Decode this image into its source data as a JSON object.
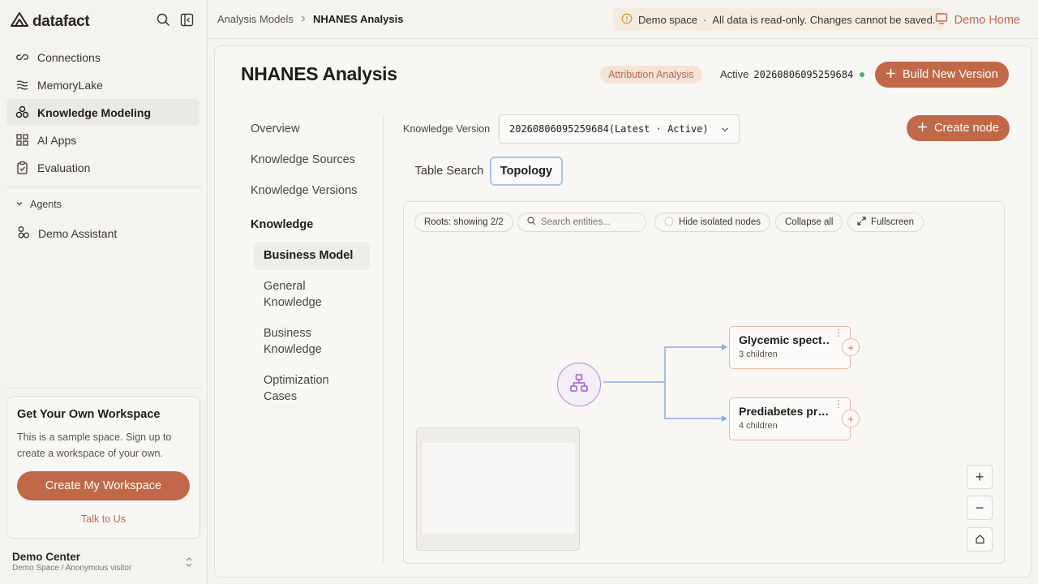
{
  "app": {
    "name": "datafact"
  },
  "sidebar": {
    "items": [
      {
        "label": "Connections",
        "icon": "link-icon"
      },
      {
        "label": "MemoryLake",
        "icon": "waves-icon"
      },
      {
        "label": "Knowledge Modeling",
        "icon": "cubes-icon",
        "active": true
      },
      {
        "label": "AI Apps",
        "icon": "grid-icon"
      },
      {
        "label": "Evaluation",
        "icon": "clipboard-icon"
      }
    ],
    "agents_header": "Agents",
    "agents": [
      {
        "label": "Demo Assistant",
        "icon": "agent-icon"
      }
    ],
    "promo": {
      "title": "Get Your Own Workspace",
      "text": "This is a sample space. Sign up to create a workspace of your own.",
      "button": "Create My Workspace",
      "link": "Talk to Us"
    },
    "user": {
      "name": "Demo Center",
      "sub": "Demo Space / Anonymous visitor"
    }
  },
  "topbar": {
    "breadcrumb": [
      "Analysis Models",
      "NHANES Analysis"
    ],
    "notice": "Demo space",
    "notice_detail": "All data is read-only. Changes cannot be saved.",
    "demo_home": "Demo Home"
  },
  "page": {
    "title": "NHANES Analysis",
    "tag": "Attribution Analysis",
    "active_label": "Active",
    "active_version": "20260806095259684",
    "build_button": "Build New Version"
  },
  "subnav": {
    "items": [
      "Overview",
      "Knowledge Sources",
      "Knowledge Versions"
    ],
    "section": "Knowledge",
    "children": [
      "Business Model",
      "General Knowledge",
      "Business Knowledge",
      "Optimization Cases"
    ]
  },
  "knowledge_version": {
    "label": "Knowledge Version",
    "value": "20260806095259684(Latest · Active)"
  },
  "create_node": "Create node",
  "tabs": [
    "Table Search",
    "Topology"
  ],
  "toolbar": {
    "roots": "Roots: showing 2/2",
    "search_placeholder": "Search entities...",
    "hide_isolated": "Hide isolated nodes",
    "collapse_all": "Collapse all",
    "fullscreen": "Fullscreen"
  },
  "graph": {
    "nodes": [
      {
        "title": "Glycemic spect…",
        "children": "3 children"
      },
      {
        "title": "Prediabetes pr…",
        "children": "4 children"
      }
    ]
  },
  "zoom": {
    "in": "+",
    "out": "−"
  },
  "colors": {
    "accent": "#c06848",
    "root_node": "#b58ad8",
    "edge": "#8fa8e8",
    "active_dot": "#4caf6a"
  }
}
